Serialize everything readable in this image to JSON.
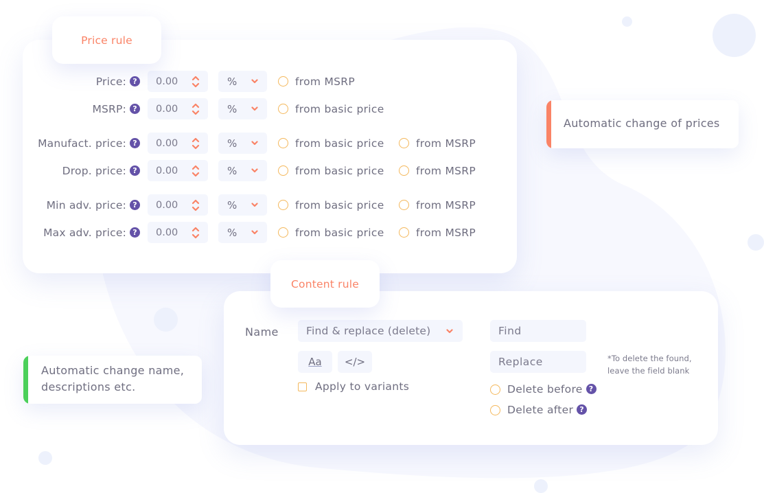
{
  "colors": {
    "accent": "#fa8366",
    "help_icon": "#6452a8",
    "radio_border": "#f4b85c",
    "input_bg": "#f4f6fd",
    "success_bar": "#4cd05a",
    "decor": "#edf1fc"
  },
  "price_rule": {
    "title": "Price rule",
    "rows": [
      {
        "label": "Price:",
        "value": "0.00",
        "unit": "%",
        "options": [
          "from MSRP"
        ]
      },
      {
        "label": "MSRP:",
        "value": "0.00",
        "unit": "%",
        "options": [
          "from basic price"
        ]
      },
      {
        "label": "Manufact. price:",
        "value": "0.00",
        "unit": "%",
        "options": [
          "from basic price",
          "from MSRP"
        ]
      },
      {
        "label": "Drop. price:",
        "value": "0.00",
        "unit": "%",
        "options": [
          "from basic price",
          "from MSRP"
        ]
      },
      {
        "label": "Min adv. price:",
        "value": "0.00",
        "unit": "%",
        "options": [
          "from basic price",
          "from MSRP"
        ]
      },
      {
        "label": "Max adv. price:",
        "value": "0.00",
        "unit": "%",
        "options": [
          "from basic price",
          "from MSRP"
        ]
      }
    ],
    "help_glyph": "?"
  },
  "info": {
    "prices": "Automatic change of prices",
    "content_line1": "Automatic change name,",
    "content_line2": "descriptions etc."
  },
  "content_rule": {
    "title": "Content rule",
    "field_label": "Name",
    "action_select": "Find & replace (delete)",
    "case_button": "Aa",
    "html_button": "</>",
    "apply_variants": "Apply to variants",
    "find_placeholder": "Find",
    "replace_placeholder": "Replace",
    "note_line1": "*To delete the found,",
    "note_line2": "leave the field blank",
    "delete_before": "Delete before",
    "delete_after": "Delete after",
    "help_glyph": "?"
  }
}
